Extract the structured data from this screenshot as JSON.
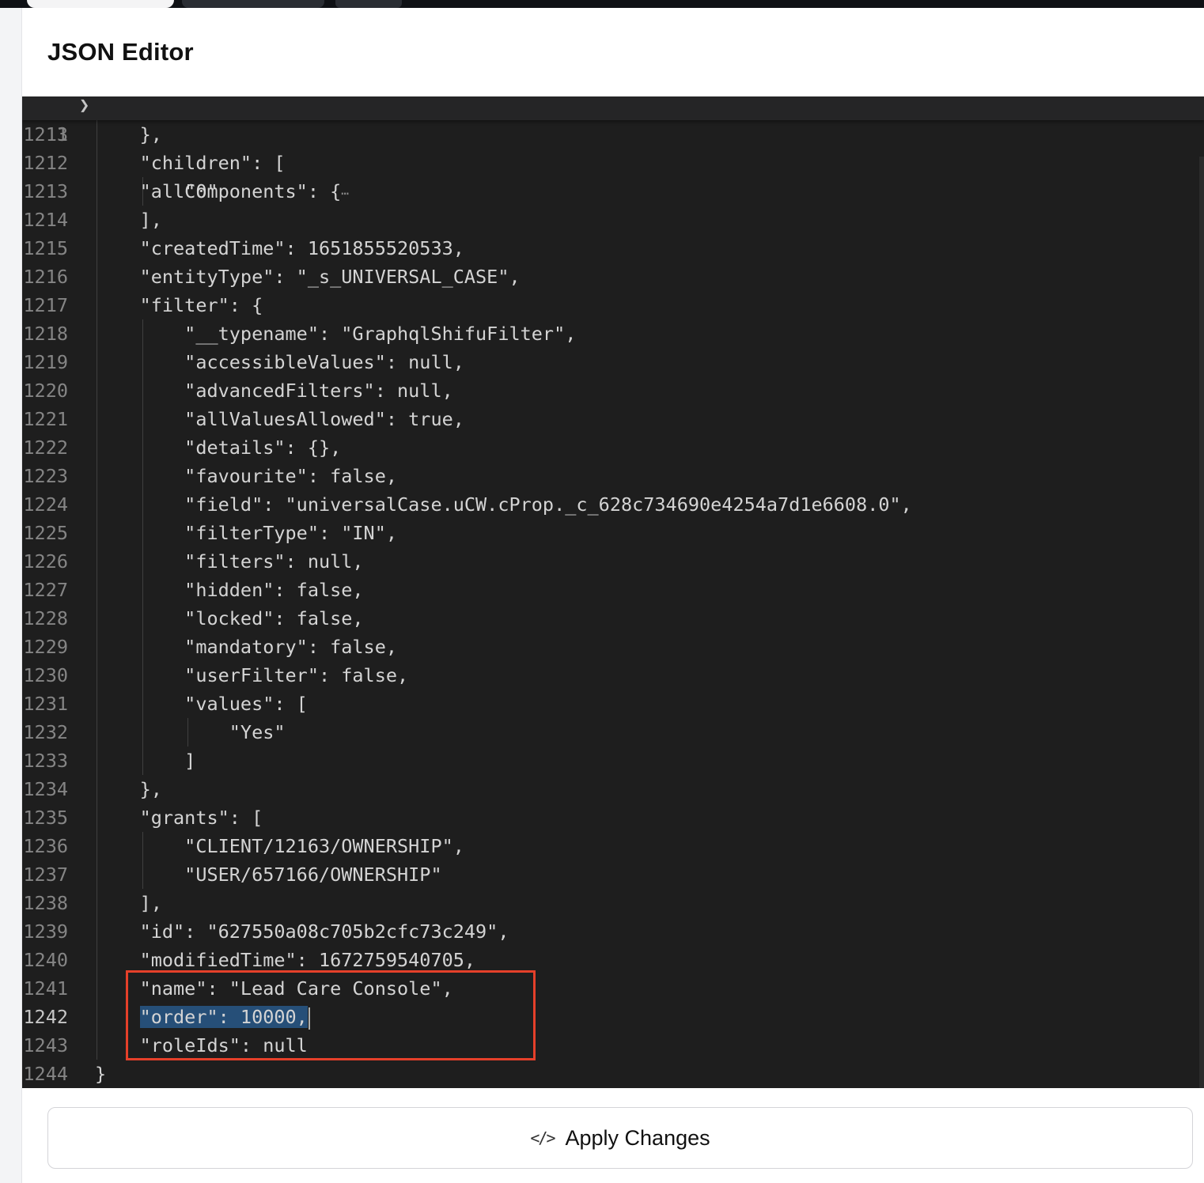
{
  "header": {
    "title": "JSON Editor"
  },
  "editor": {
    "sticky_line": {
      "number": "3",
      "text": "    \"allComponents\": {",
      "ellipsis": "⋯"
    },
    "lines": [
      {
        "n": "1211",
        "text": "    },"
      },
      {
        "n": "1212",
        "text": "    \"children\": ["
      },
      {
        "n": "1213",
        "text": "        \"0\""
      },
      {
        "n": "1214",
        "text": "    ],"
      },
      {
        "n": "1215",
        "text": "    \"createdTime\": 1651855520533,"
      },
      {
        "n": "1216",
        "text": "    \"entityType\": \"_s_UNIVERSAL_CASE\","
      },
      {
        "n": "1217",
        "text": "    \"filter\": {"
      },
      {
        "n": "1218",
        "text": "        \"__typename\": \"GraphqlShifuFilter\","
      },
      {
        "n": "1219",
        "text": "        \"accessibleValues\": null,"
      },
      {
        "n": "1220",
        "text": "        \"advancedFilters\": null,"
      },
      {
        "n": "1221",
        "text": "        \"allValuesAllowed\": true,"
      },
      {
        "n": "1222",
        "text": "        \"details\": {},"
      },
      {
        "n": "1223",
        "text": "        \"favourite\": false,"
      },
      {
        "n": "1224",
        "text": "        \"field\": \"universalCase.uCW.cProp._c_628c734690e4254a7d1e6608.0\","
      },
      {
        "n": "1225",
        "text": "        \"filterType\": \"IN\","
      },
      {
        "n": "1226",
        "text": "        \"filters\": null,"
      },
      {
        "n": "1227",
        "text": "        \"hidden\": false,"
      },
      {
        "n": "1228",
        "text": "        \"locked\": false,"
      },
      {
        "n": "1229",
        "text": "        \"mandatory\": false,"
      },
      {
        "n": "1230",
        "text": "        \"userFilter\": false,"
      },
      {
        "n": "1231",
        "text": "        \"values\": ["
      },
      {
        "n": "1232",
        "text": "            \"Yes\""
      },
      {
        "n": "1233",
        "text": "        ]"
      },
      {
        "n": "1234",
        "text": "    },"
      },
      {
        "n": "1235",
        "text": "    \"grants\": ["
      },
      {
        "n": "1236",
        "text": "        \"CLIENT/12163/OWNERSHIP\","
      },
      {
        "n": "1237",
        "text": "        \"USER/657166/OWNERSHIP\""
      },
      {
        "n": "1238",
        "text": "    ],"
      },
      {
        "n": "1239",
        "text": "    \"id\": \"627550a08c705b2cfc73c249\","
      },
      {
        "n": "1240",
        "text": "    \"modifiedTime\": 1672759540705,"
      },
      {
        "n": "1241",
        "text": "    \"name\": \"Lead Care Console\","
      },
      {
        "n": "1242",
        "text": "    \"order\": 10000,",
        "selected": true,
        "active": true
      },
      {
        "n": "1243",
        "text": "    \"roleIds\": null"
      },
      {
        "n": "1244",
        "text": "}"
      }
    ]
  },
  "footer": {
    "apply_label": "Apply Changes",
    "apply_icon": "code-icon"
  },
  "colors": {
    "editor_bg": "#1e1e1e",
    "selection": "#264f78",
    "annotation_box": "#e5402a"
  }
}
